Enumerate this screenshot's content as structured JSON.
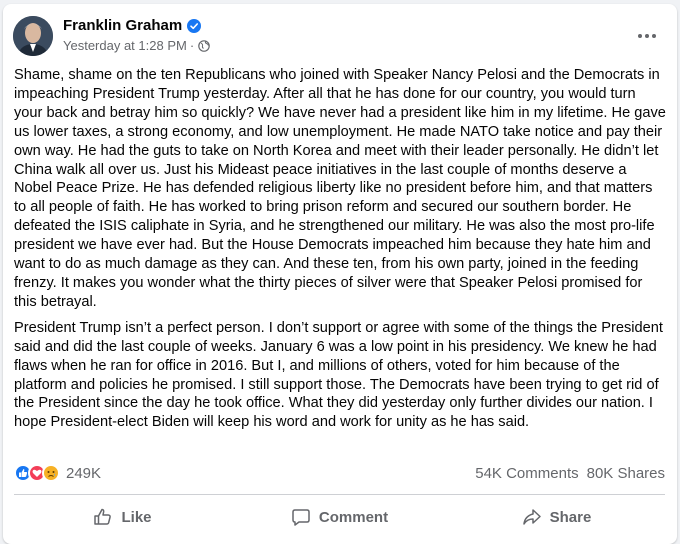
{
  "post": {
    "author": "Franklin Graham",
    "timestamp": "Yesterday at 1:28 PM",
    "separator": "·",
    "privacy_icon": "globe-icon",
    "verified_icon": "verified-badge-icon",
    "more_icon": "more-options-icon",
    "paragraphs": [
      "Shame, shame on the ten Republicans who joined with Speaker Nancy Pelosi and the Democrats in impeaching President Trump yesterday. After all that he has done for our country, you would turn your back and betray him so quickly? We have never had a president like him in my lifetime. He gave us lower taxes, a strong economy, and low unemployment. He made NATO take notice and pay their own way. He had the guts to take on North Korea and meet with their leader personally. He didn’t let China walk all over us. Just his Mideast peace initiatives in the last couple of months deserve a Nobel Peace Prize. He has defended religious liberty like no president before him, and that matters to all people of faith. He has worked to bring prison reform and secured our southern border. He defeated the ISIS caliphate in Syria, and he strengthened our military. He was also the most pro-life president we have ever had. But the House Democrats impeached him because they hate him and want to do as much damage as they can. And these ten, from his own party, joined in the feeding frenzy. It makes you wonder what the thirty pieces of silver were that Speaker Pelosi promised for this betrayal.",
      "President Trump isn’t a perfect person. I don’t support or agree with some of the things the President said and did the last couple of weeks. January 6 was a low point in his presidency. We knew he had flaws when he ran for office in 2016. But I, and millions of others, voted for him because of the platform and policies he promised. I still support those. The Democrats have been trying to get rid of the President since the day he took office. What they did yesterday only further divides our nation. I hope President-elect Biden will keep his word and work for unity as he has said."
    ]
  },
  "stats": {
    "reaction_icons": [
      "like-reaction-icon",
      "love-reaction-icon",
      "sad-reaction-icon"
    ],
    "reactions": "249K",
    "comments": "54K Comments",
    "shares": "80K Shares"
  },
  "actions": {
    "like": "Like",
    "comment": "Comment",
    "share": "Share"
  },
  "colors": {
    "accent": "#1877f2",
    "secondary_text": "#65676b",
    "love": "#f33e58",
    "sad": "#f7b125"
  }
}
